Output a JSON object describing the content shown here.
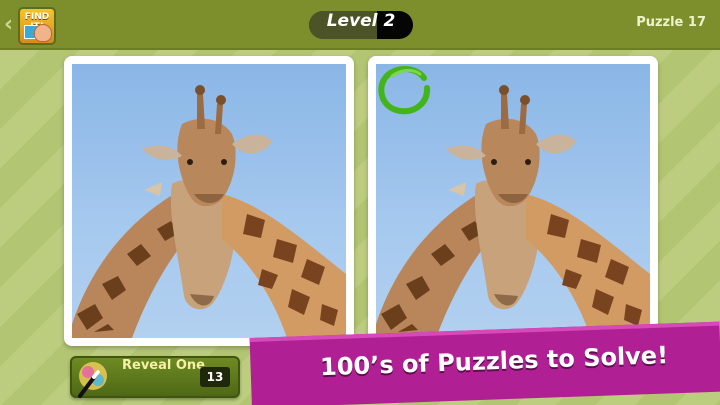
{
  "header": {
    "app_icon_text": "FIND IT!",
    "level_label": "Level",
    "level_number": "2",
    "puzzle_label": "Puzzle 17"
  },
  "game": {
    "differences_found": 1
  },
  "toolbar": {
    "reveal_label": "Reveal One",
    "reveal_count": "13"
  },
  "promo": {
    "banner_text": "100’s of Puzzles to Solve!"
  },
  "colors": {
    "topbar": "#7c8f2c",
    "background": "#b8cc78",
    "banner": "#b01f93",
    "found_marker": "#43b51a"
  }
}
